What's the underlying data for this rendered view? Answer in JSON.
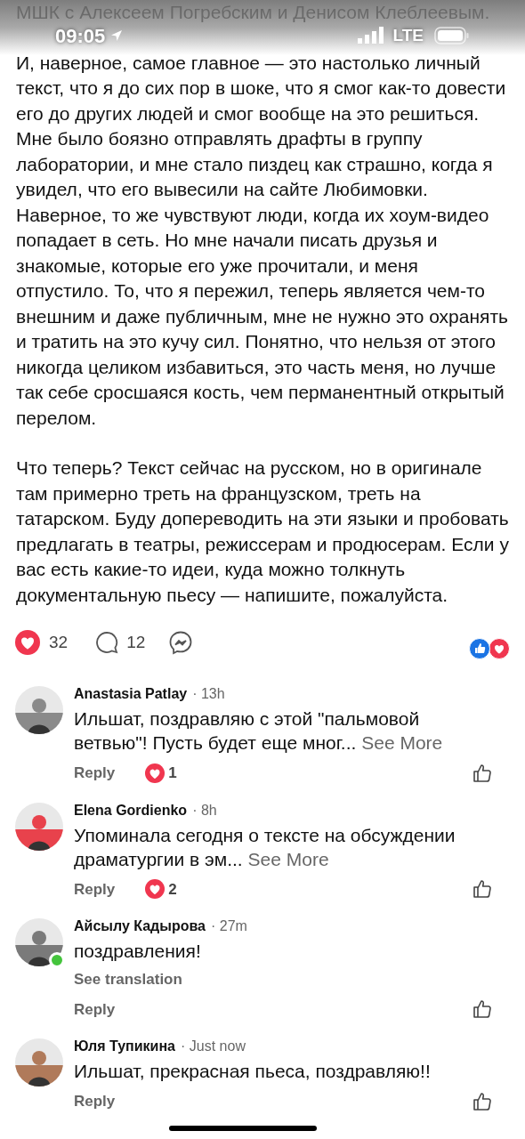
{
  "status_bar": {
    "time": "09:05",
    "network": "LTE"
  },
  "post": {
    "lead_text": "МШК с Алексеем Погребским и Денисом Клеблеевым.",
    "paragraphs": [
      "И, наверное, самое главное — это настолько личный текст, что я до сих пор в шоке, что я смог как-то довести его до других людей и смог вообще на это решиться. Мне было боязно отправлять драфты в группу лаборатории, и мне стало пиздец как страшно, когда я увидел, что его вывесили на сайте Любимовки. Наверное, то же чувствуют люди, когда их хоум-видео попадает в сеть. Но мне начали писать друзья и знакомые, которые его уже прочитали, и меня отпустило. То, что я пережил, теперь является чем-то внешним и даже публичным, мне не нужно это охранять и тратить на это кучу сил. Понятно, что нельзя от этого никогда целиком избавиться, это часть меня, но лучше так себе сросшаяся кость, чем перманентный открытый перелом.",
      "Что теперь? Текст сейчас на русском, но в оригинале там примерно треть на французском, треть на татарском. Буду допереводить на эти языки и пробовать предлагать в театры, режиссерам и продюсерам. Если у вас есть какие-то идеи, куда можно толкнуть документальную пьесу —  напишите, пожалуйста."
    ],
    "reactions_count": "32",
    "comments_count": "12"
  },
  "comments": [
    {
      "author": "Anastasia Patlay",
      "time": "· 13h",
      "text": "Ильшат, поздравляю с этой \"пальмовой ветвью\"! Пусть будет еще мног...",
      "see_more": "See More",
      "reply": "Reply",
      "reactions": "1",
      "online": false
    },
    {
      "author": "Elena Gordienko",
      "time": "· 8h",
      "text": "Упоминала сегодня о тексте на обсуждении драматургии в эм...",
      "see_more": "See More",
      "reply": "Reply",
      "reactions": "2",
      "online": false
    },
    {
      "author": "Айсылу Кадырова",
      "time": "· 27m",
      "text": "поздравления!",
      "translation": "See translation",
      "reply": "Reply",
      "online": true
    },
    {
      "author": "Юля Тупикина",
      "time": "· Just now",
      "text": "Ильшат, прекрасная пьеса, поздравляю!!",
      "reply": "Reply",
      "online": false
    }
  ]
}
